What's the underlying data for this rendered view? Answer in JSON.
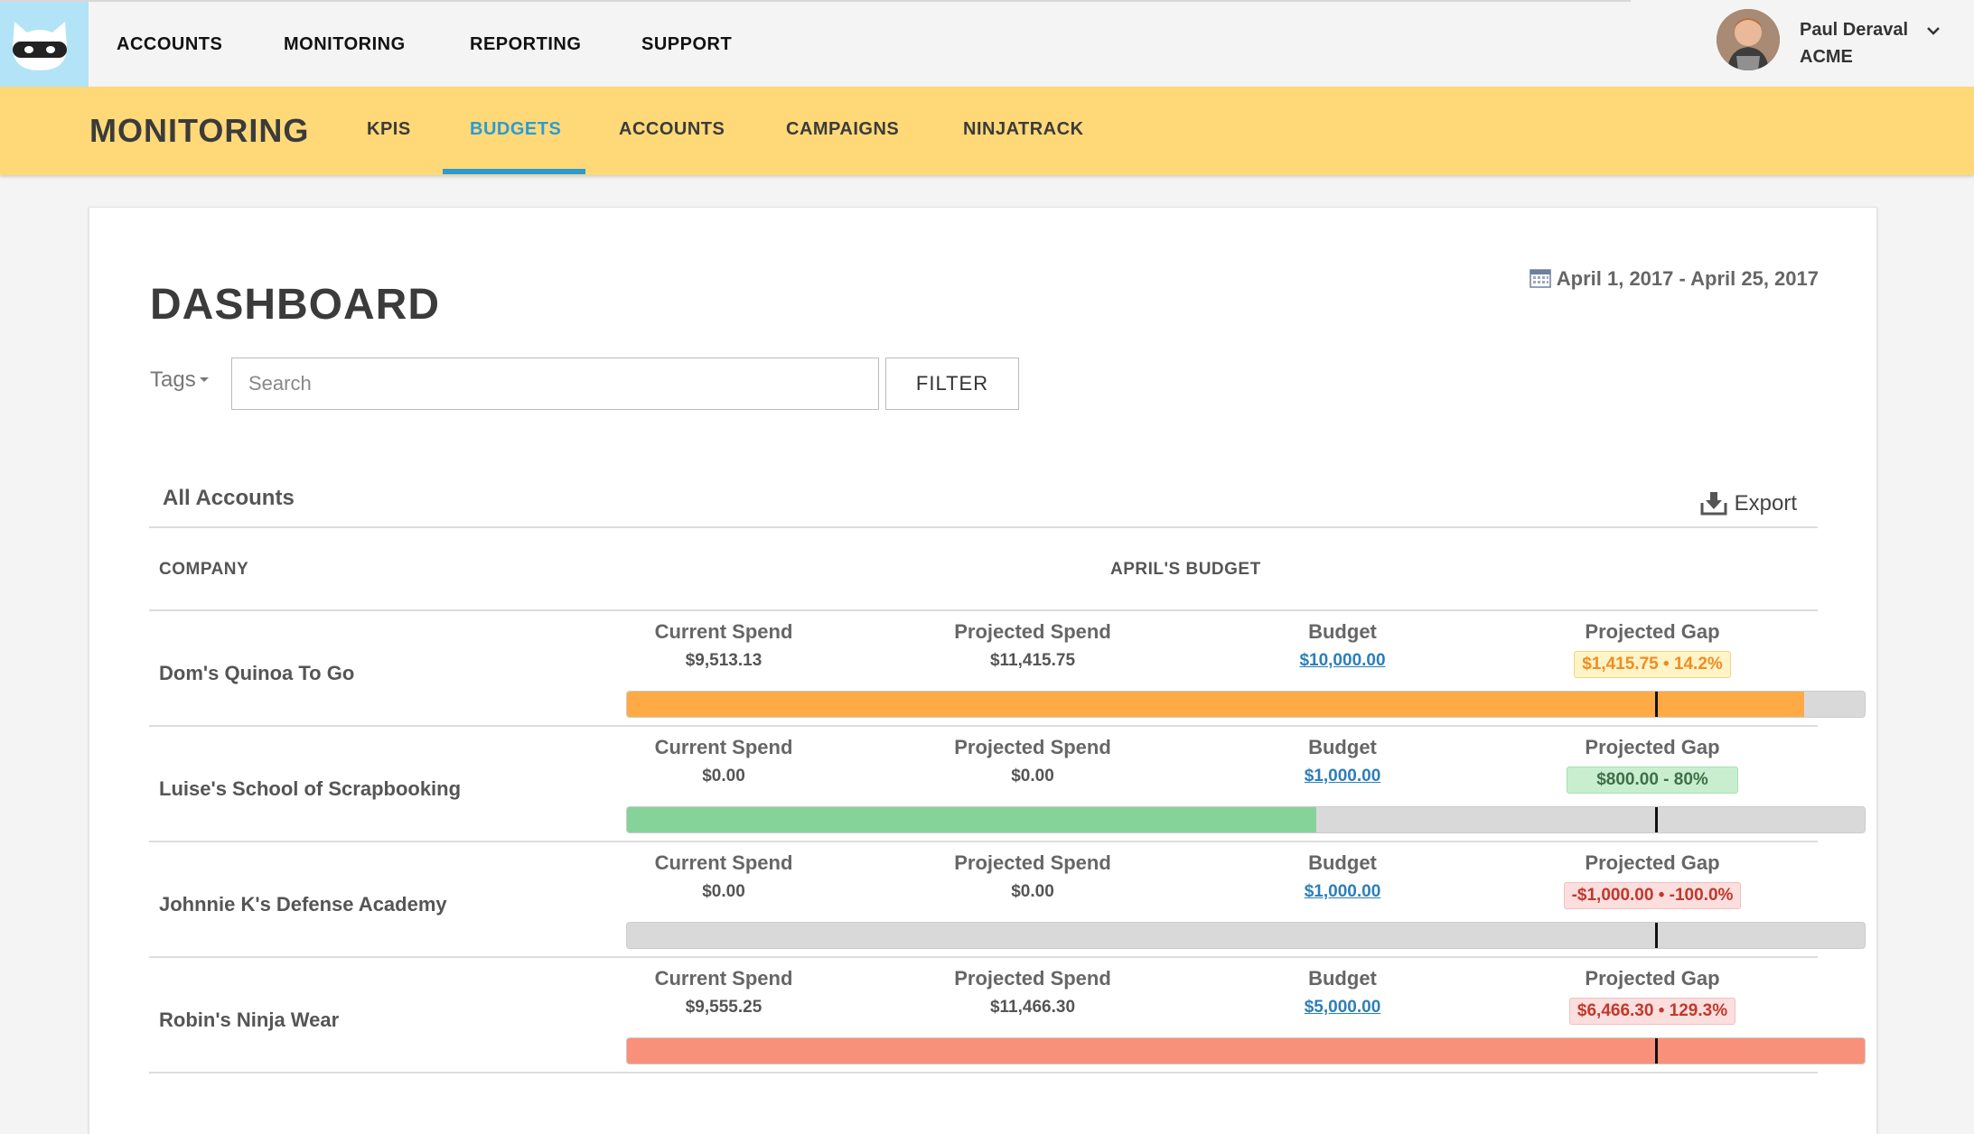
{
  "topnav": {
    "items": [
      "ACCOUNTS",
      "MONITORING",
      "REPORTING",
      "SUPPORT"
    ]
  },
  "user": {
    "name": "Paul Deraval",
    "org": "ACME"
  },
  "subnav": {
    "title": "MONITORING",
    "items": [
      "KPIS",
      "BUDGETS",
      "ACCOUNTS",
      "CAMPAIGNS",
      "NINJATRACK"
    ],
    "active": "BUDGETS"
  },
  "dashboard": {
    "title": "DASHBOARD",
    "date_range": "April 1, 2017 - April 25, 2017",
    "tags_label": "Tags",
    "search_placeholder": "Search",
    "filter_label": "FILTER",
    "section_title": "All Accounts",
    "export_label": "Export",
    "col_company": "COMPANY",
    "col_budget": "APRIL'S BUDGET",
    "labels": {
      "current_spend": "Current Spend",
      "projected_spend": "Projected Spend",
      "budget": "Budget",
      "projected_gap": "Projected Gap"
    },
    "rows": [
      {
        "company": "Dom's Quinoa To Go",
        "current_spend": "$9,513.13",
        "projected_spend": "$11,415.75",
        "budget": "$10,000.00",
        "projected_gap": "$1,415.75 • 14.2%",
        "gap_status": "orange",
        "bar_fraction": 0.951,
        "marker_fraction": 0.831,
        "bar_color": "#ffaa45"
      },
      {
        "company": "Luise's School of Scrapbooking",
        "current_spend": "$0.00",
        "projected_spend": "$0.00",
        "budget": "$1,000.00",
        "projected_gap": "$800.00 - 80%",
        "gap_status": "green",
        "bar_fraction": 0.557,
        "marker_fraction": 0.831,
        "bar_color": "#86d39a"
      },
      {
        "company": "Johnnie K's Defense Academy",
        "current_spend": "$0.00",
        "projected_spend": "$0.00",
        "budget": "$1,000.00",
        "projected_gap": "-$1,000.00 • -100.0%",
        "gap_status": "red",
        "bar_fraction": 0.0,
        "marker_fraction": 0.831,
        "bar_color": "#f9907a"
      },
      {
        "company": "Robin's Ninja Wear",
        "current_spend": "$9,555.25",
        "projected_spend": "$11,466.30",
        "budget": "$5,000.00",
        "projected_gap": "$6,466.30 • 129.3%",
        "gap_status": "red",
        "bar_fraction": 1.0,
        "marker_fraction": 0.831,
        "bar_color": "#f9907a"
      }
    ]
  },
  "colors": {
    "accent": "#2c9bd3",
    "subbar": "#ffd978",
    "logo_bg": "#b3e3f7"
  },
  "icons": [
    "ninja-cat-logo-icon",
    "chevron-down-icon",
    "calendar-icon",
    "download-icon",
    "caret-down-icon"
  ]
}
